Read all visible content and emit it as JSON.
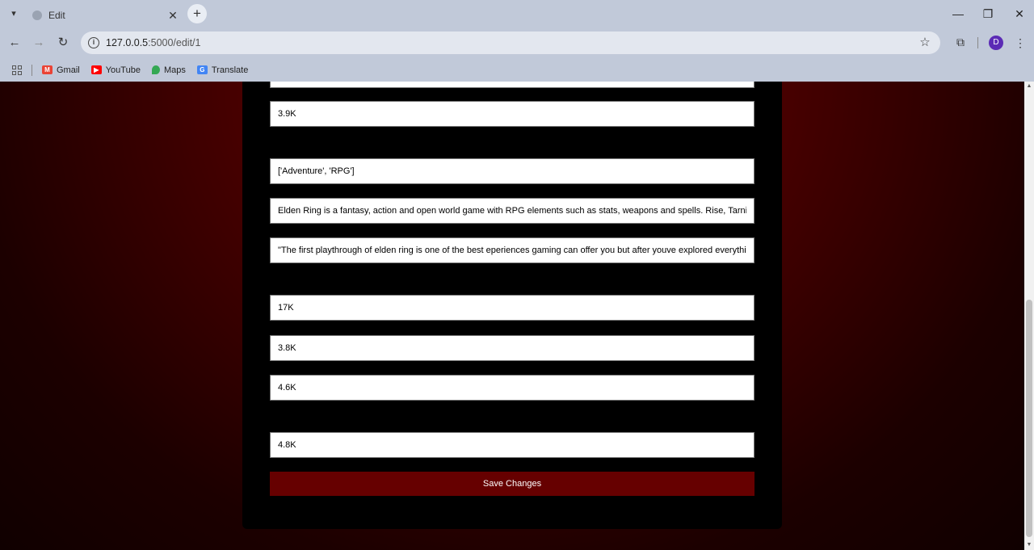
{
  "browser": {
    "tab": {
      "title": "Edit",
      "close_glyph": "✕"
    },
    "new_tab_glyph": "+",
    "window": {
      "minimize": "—",
      "restore": "❐",
      "close": "✕"
    },
    "nav": {
      "back": "←",
      "forward": "→",
      "reload": "↻"
    },
    "address": {
      "host": "127.0.0.5",
      "path": ":5000/edit/1"
    },
    "profile_initial": "D",
    "bookmarks": [
      {
        "label": "Gmail",
        "icon": "gmail-icon",
        "color": "#ea4335"
      },
      {
        "label": "YouTube",
        "icon": "youtube-icon",
        "color": "#ff0000"
      },
      {
        "label": "Maps",
        "icon": "maps-icon",
        "color": "#34a853"
      },
      {
        "label": "Translate",
        "icon": "translate-icon",
        "color": "#4285f4"
      }
    ]
  },
  "form": {
    "fields": [
      {
        "value": ""
      },
      {
        "value": "3.9K"
      },
      {
        "value": "['Adventure', 'RPG']"
      },
      {
        "value": "Elden Ring is a fantasy, action and open world game with RPG elements such as stats, weapons and spells. Rise, Tarnished"
      },
      {
        "value": "\"The first playthrough of elden ring is one of the best eperiences gaming can offer you but after youve explored everything"
      },
      {
        "value": "17K"
      },
      {
        "value": "3.8K"
      },
      {
        "value": "4.6K"
      },
      {
        "value": "4.8K"
      }
    ],
    "save_label": "Save Changes"
  },
  "colors": {
    "accent": "#660000",
    "panel": "#000000",
    "bg_glow": "#7a0000"
  }
}
